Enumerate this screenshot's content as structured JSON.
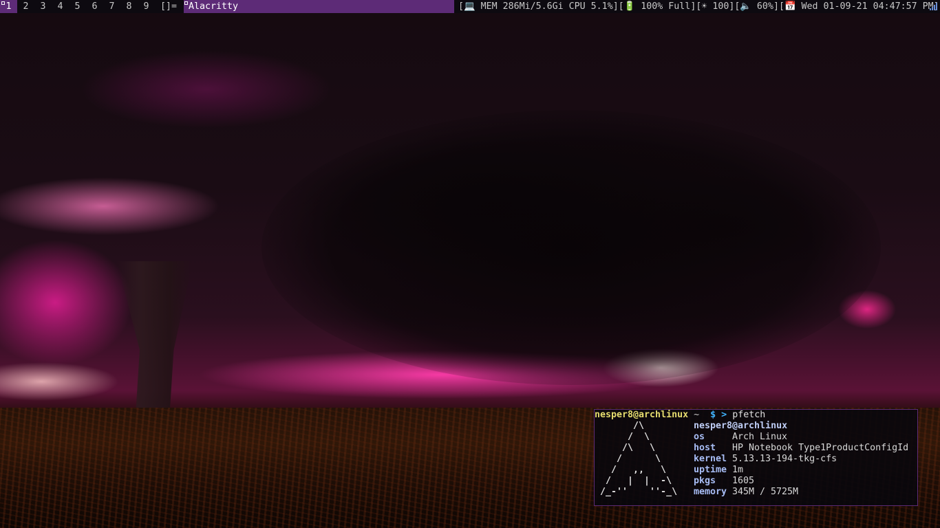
{
  "bar": {
    "tags": [
      "1",
      "2",
      "3",
      "4",
      "5",
      "6",
      "7",
      "8",
      "9"
    ],
    "active_tag": "1",
    "layout_symbol": "[]=",
    "window_title": "Alacritty",
    "status_text": "[💻 MEM 286Mi/5.6Gi CPU 5.1%][🔋 100% Full][☀ 100][🔈 60%][📅 Wed 01-09-21 04:47:57 PM]",
    "accent_color": "#5d2b77",
    "tray_icon": "signal-bars-icon"
  },
  "terminal": {
    "prompt_user": "nesper8@archlinux",
    "prompt_dir": "~",
    "prompt_symbol": "$ >",
    "command": "pfetch",
    "title": "nesper8@archlinux",
    "art": [
      "      /\\",
      "     /  \\",
      "    /\\   \\",
      "   /      \\",
      "  /   ,,   \\",
      " /   |  |  -\\",
      "/_-''    ''-_\\"
    ],
    "info": [
      {
        "key": "os",
        "value": "Arch Linux"
      },
      {
        "key": "host",
        "value": "HP Notebook Type1ProductConfigId"
      },
      {
        "key": "kernel",
        "value": "5.13.13-194-tkg-cfs"
      },
      {
        "key": "uptime",
        "value": "1m"
      },
      {
        "key": "pkgs",
        "value": "1605"
      },
      {
        "key": "memory",
        "value": "345M / 5725M"
      }
    ]
  }
}
